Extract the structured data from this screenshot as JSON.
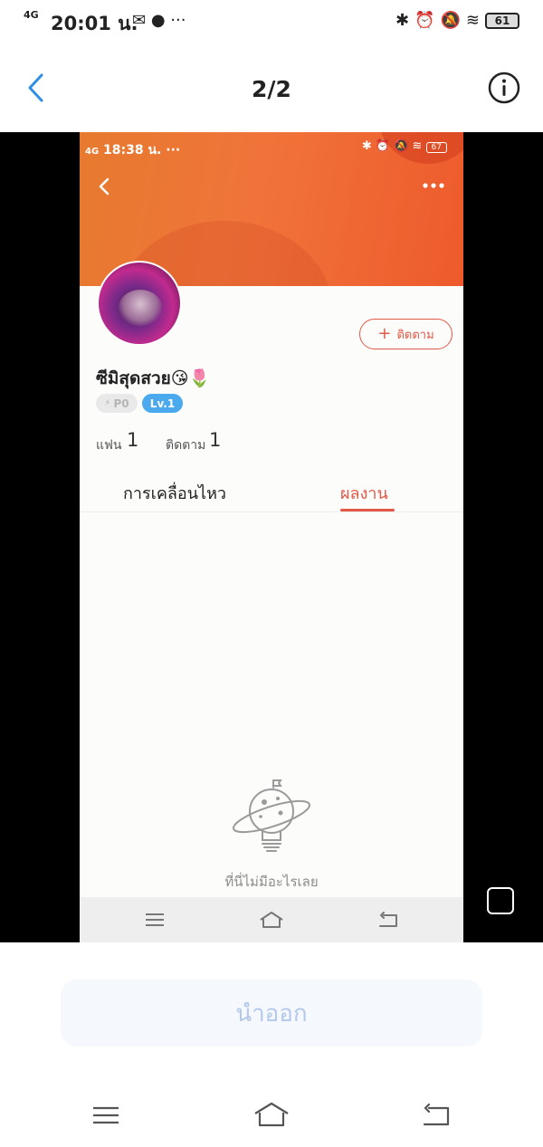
{
  "status_bar": {
    "network": "4G",
    "time": "20:01 น.",
    "extra": "···",
    "battery": "61"
  },
  "header": {
    "back_icon": "chevron-left-icon",
    "title": "2/2",
    "info_icon": "info-icon"
  },
  "screenshot": {
    "status_bar": {
      "network": "4G",
      "time": "18:38 น.",
      "extra": "···",
      "battery": "67"
    },
    "profile": {
      "name": "ซีมิสุดสวย😘🌷",
      "badge_p": "P0",
      "badge_lv": "Lv.1",
      "follow_label": "ติดตาม",
      "fans_label": "แฟน",
      "fans_count": "1",
      "following_label": "ติดตาม",
      "following_count": "1"
    },
    "tabs": [
      {
        "label": "การเคลื่อนไหว",
        "active": false
      },
      {
        "label": "ผลงาน",
        "active": true
      }
    ],
    "empty_text": "ที่นี่ไม่มีอะไรเลย"
  },
  "actions": {
    "remove_label": "นำออก"
  },
  "colors": {
    "accent": "#e25847",
    "link_blue": "#2f8ee6",
    "banner_orange": "#ee6a33",
    "level_blue": "#4ba9ee"
  }
}
